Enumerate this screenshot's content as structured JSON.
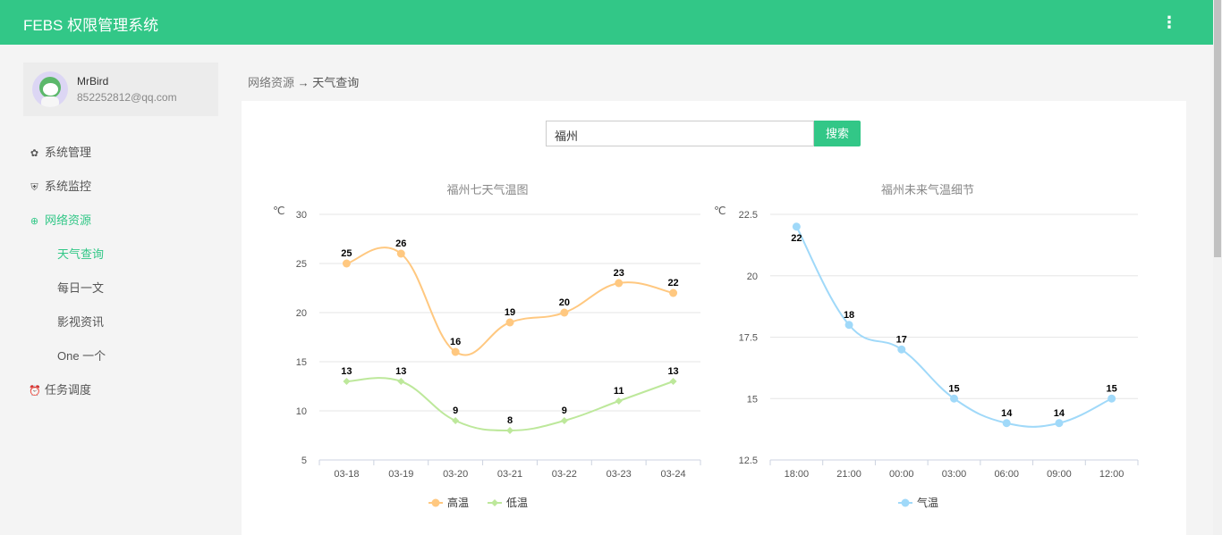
{
  "header": {
    "title": "FEBS 权限管理系统",
    "more_icon": "vertical-ellipsis"
  },
  "user": {
    "name": "MrBird",
    "email": "852252812@qq.com"
  },
  "nav": {
    "items": [
      {
        "label": "系统管理",
        "icon": "gear-icon"
      },
      {
        "label": "系统监控",
        "icon": "shield-icon"
      },
      {
        "label": "网络资源",
        "icon": "globe-icon"
      },
      {
        "label": "任务调度",
        "icon": "clock-icon"
      }
    ],
    "sub_items": [
      {
        "label": "天气查询"
      },
      {
        "label": "每日一文"
      },
      {
        "label": "影视资讯"
      },
      {
        "label": "One 一个"
      }
    ]
  },
  "breadcrumb": {
    "parent": "网络资源",
    "arrow": "→",
    "current": "天气查询"
  },
  "search": {
    "value": "福州",
    "button": "搜索"
  },
  "colors": {
    "accent": "#32c787",
    "high": "#ffc880",
    "low": "#bde89b",
    "temp": "#a0d9f9"
  },
  "chart_data": [
    {
      "type": "line",
      "title": "福州七天气温图",
      "ylabel": "℃",
      "ylim": [
        5,
        30
      ],
      "yticks": [
        5,
        10,
        15,
        20,
        25,
        30
      ],
      "categories": [
        "03-18",
        "03-19",
        "03-20",
        "03-21",
        "03-22",
        "03-23",
        "03-24"
      ],
      "grid": true,
      "legend": "bottom",
      "series": [
        {
          "name": "高温",
          "values": [
            25,
            26,
            16,
            19,
            20,
            23,
            22
          ],
          "color": "#ffc880",
          "marker": "circle"
        },
        {
          "name": "低温",
          "values": [
            13,
            13,
            9,
            8,
            9,
            11,
            13
          ],
          "color": "#bde89b",
          "marker": "diamond"
        }
      ]
    },
    {
      "type": "line",
      "title": "福州未来气温细节",
      "ylabel": "℃",
      "ylim": [
        12.5,
        22.5
      ],
      "yticks": [
        12.5,
        15,
        17.5,
        20,
        22.5
      ],
      "categories": [
        "18:00",
        "21:00",
        "00:00",
        "03:00",
        "06:00",
        "09:00",
        "12:00"
      ],
      "grid": true,
      "legend": "bottom",
      "series": [
        {
          "name": "气温",
          "values": [
            22,
            18,
            17,
            15,
            14,
            14,
            15
          ],
          "color": "#a0d9f9",
          "marker": "circle"
        }
      ]
    }
  ]
}
